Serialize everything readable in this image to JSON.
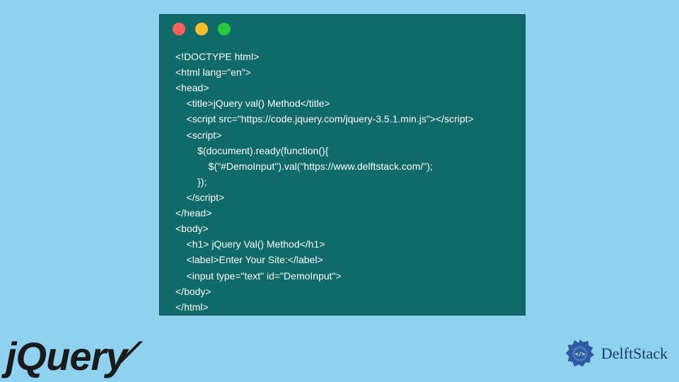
{
  "code_window": {
    "lines": [
      "<!DOCTYPE html>",
      "<html lang=\"en\">",
      "<head>",
      "    <title>jQuery val() Method</title>",
      "    <script src=\"https://code.jquery.com/jquery-3.5.1.min.js\"></script>",
      "    <script>",
      "        $(document).ready(function(){",
      "            $(\"#DemoInput\").val(\"https://www.delftstack.com/\");",
      "        });",
      "    </script>",
      "</head>",
      "<body>",
      "    <h1> jQuery Val() Method</h1>",
      "    <label>Enter Your Site:</label>",
      "    <input type=\"text\" id=\"DemoInput\">",
      "</body>",
      "</html>"
    ]
  },
  "logos": {
    "jquery": "jQuery",
    "delftstack": "DelftStack"
  },
  "colors": {
    "page_bg": "#8ed2f0",
    "window_bg": "#0f6a6a",
    "dot_red": "#ff5f56",
    "dot_yellow": "#ffbd2e",
    "dot_green": "#27c93f",
    "delft_blue": "#2d5aa0"
  }
}
